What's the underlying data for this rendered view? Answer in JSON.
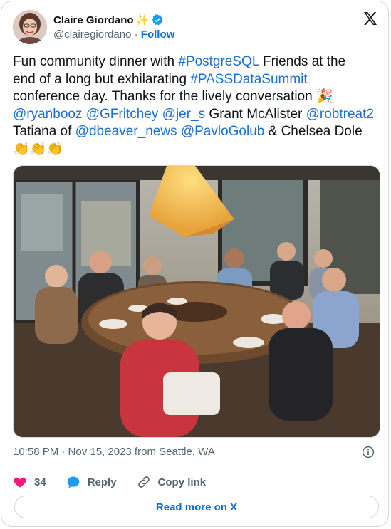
{
  "author": {
    "name": "Claire Giordano",
    "name_emoji": "✨",
    "handle": "@clairegiordano",
    "separator": "·",
    "follow_label": "Follow"
  },
  "tweet": {
    "lines": [
      [
        {
          "t": "Fun community dinner with "
        },
        {
          "t": "#PostgreSQL",
          "link": true
        },
        {
          "t": " Friends at the"
        }
      ],
      [
        {
          "t": "end of a long but exhilarating "
        },
        {
          "t": "#PASSDataSummit",
          "link": true
        }
      ],
      [
        {
          "t": "conference day. Thanks for the lively conversation 🎉"
        }
      ],
      [
        {
          "t": "@ryanbooz",
          "link": true
        },
        {
          "t": " "
        },
        {
          "t": "@GFritchey",
          "link": true
        },
        {
          "t": " "
        },
        {
          "t": "@jer_s",
          "link": true
        },
        {
          "t": " Grant McAlister "
        },
        {
          "t": "@robtreat2",
          "link": true
        }
      ],
      [
        {
          "t": "Tatiana of "
        },
        {
          "t": "@dbeaver_news",
          "link": true
        },
        {
          "t": " "
        },
        {
          "t": "@PavloGolub",
          "link": true
        },
        {
          "t": " & Chelsea Dole"
        }
      ],
      [
        {
          "t": "👏👏👏"
        }
      ]
    ]
  },
  "photo_alt": "Group photo at a round dinner table in a restaurant",
  "timestamp": "10:58 PM · Nov 15, 2023 from Seattle, WA",
  "actions": {
    "likes": "34",
    "reply_label": "Reply",
    "copy_label": "Copy link"
  },
  "read_more_label": "Read more on X",
  "colors": {
    "link": "#1d6fd0",
    "heart": "#f91880",
    "reply": "#1d9bf0",
    "verified": "#1d9bf0"
  }
}
